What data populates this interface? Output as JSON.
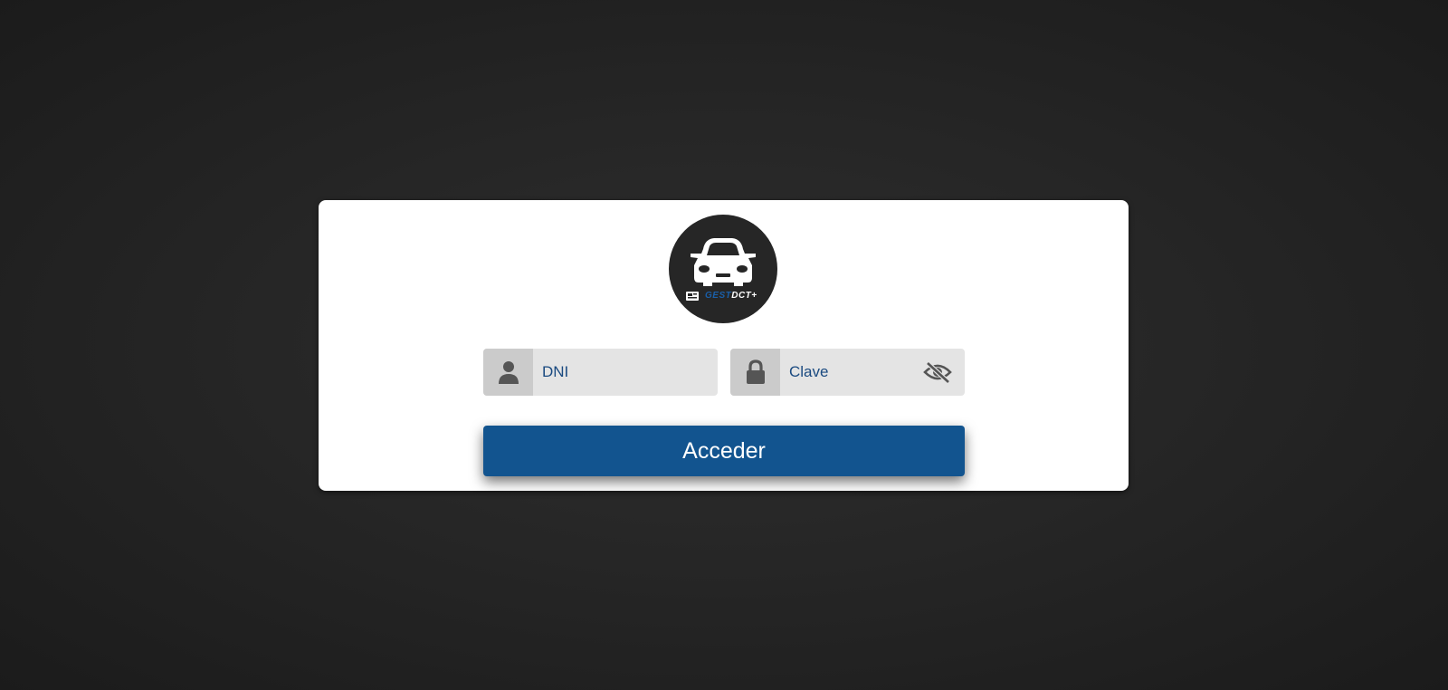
{
  "login": {
    "logo_text_part1": "GEST",
    "logo_text_part2": "DCT+",
    "dni_placeholder": "DNI",
    "clave_placeholder": "Clave",
    "submit_label": "Acceder"
  },
  "icons": {
    "logo": "car-icon",
    "dni": "user-icon",
    "clave": "lock-icon",
    "toggle": "eye-slash-icon"
  },
  "colors": {
    "background": "#262626",
    "card": "#ffffff",
    "input_bg": "#e4e4e4",
    "addon_bg": "#cbcbcb",
    "accent": "#12548f",
    "input_text": "#1a4a80"
  }
}
